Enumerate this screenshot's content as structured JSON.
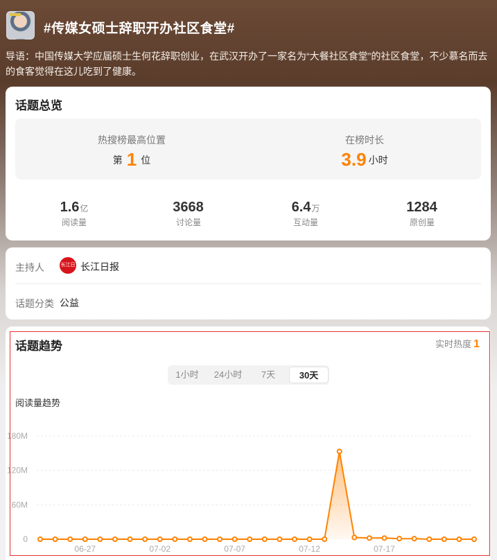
{
  "topic": {
    "title": "#传媒女硕士辞职开办社区食堂#",
    "intro": "导语：中国传媒大学应届硕士生何花辞职创业，在武汉开办了一家名为“大餐社区食堂”的社区食堂，不少慕名而去的食客觉得在这儿吃到了健康。"
  },
  "overview": {
    "title": "话题总览",
    "rank_label": "热搜榜最高位置",
    "rank_prefix": "第",
    "rank_value": "1",
    "rank_suffix": "位",
    "duration_label": "在榜时长",
    "duration_value": "3.9",
    "duration_unit": "小时",
    "stats": [
      {
        "num": "1.6",
        "unit": "亿",
        "caption": "阅读量"
      },
      {
        "num": "3668",
        "unit": "",
        "caption": "讨论量"
      },
      {
        "num": "6.4",
        "unit": "万",
        "caption": "互动量"
      },
      {
        "num": "1284",
        "unit": "",
        "caption": "原创量"
      }
    ]
  },
  "info": {
    "host_label": "主持人",
    "host_name": "长江日报",
    "host_logo_text": "长江日報",
    "category_label": "话题分类",
    "category_value": "公益"
  },
  "trend": {
    "title": "话题趋势",
    "realtime_label": "实时热度",
    "realtime_value": "1",
    "tabs": [
      "1小时",
      "24小时",
      "7天",
      "30天"
    ],
    "active_tab": "30天",
    "subtitle": "阅读量趋势"
  },
  "colors": {
    "accent": "#ff8200",
    "highlight_border": "#e0322c"
  },
  "chart_data": {
    "type": "area",
    "title": "阅读量趋势",
    "xlabel": "",
    "ylabel": "",
    "ylim": [
      0,
      180
    ],
    "y_unit": "M",
    "y_ticks": [
      "0",
      "60M",
      "120M",
      "180M"
    ],
    "x_ticks": [
      "06-27",
      "07-02",
      "07-07",
      "07-12",
      "07-17"
    ],
    "x": [
      "06-24",
      "06-25",
      "06-26",
      "06-27",
      "06-28",
      "06-29",
      "06-30",
      "07-01",
      "07-02",
      "07-03",
      "07-04",
      "07-05",
      "07-06",
      "07-07",
      "07-08",
      "07-09",
      "07-10",
      "07-11",
      "07-12",
      "07-13",
      "07-14",
      "07-15",
      "07-16",
      "07-17",
      "07-18",
      "07-19",
      "07-20",
      "07-21",
      "07-22",
      "07-23"
    ],
    "series": [
      {
        "values": [
          0,
          0,
          0,
          0,
          0,
          0,
          0,
          0,
          0,
          0,
          0,
          0,
          0,
          0,
          0,
          0,
          0,
          0,
          0,
          0,
          153,
          3,
          2,
          2,
          1,
          1,
          0,
          0,
          0,
          0
        ]
      }
    ],
    "grid": true,
    "legend": "none"
  }
}
